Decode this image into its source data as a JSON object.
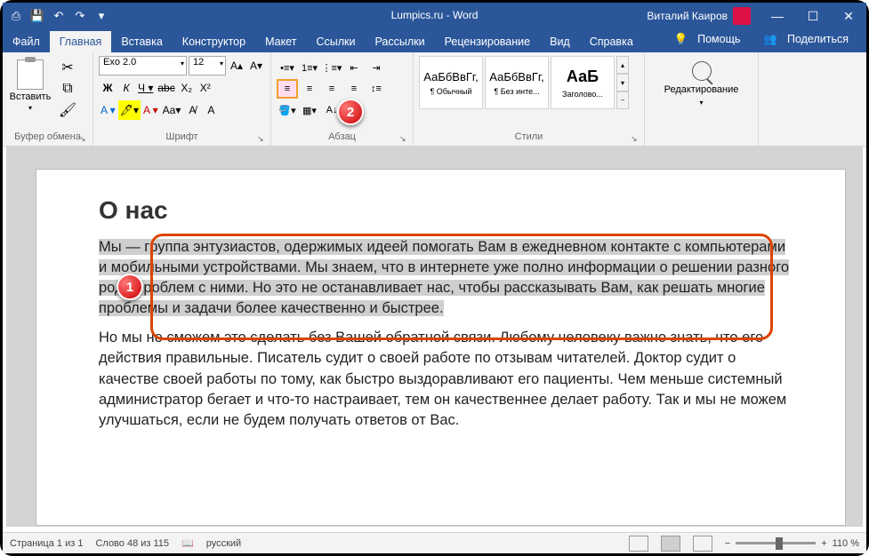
{
  "titlebar": {
    "title": "Lumpics.ru - Word",
    "user": "Виталий Каиров"
  },
  "tabs": {
    "items": [
      "Файл",
      "Главная",
      "Вставка",
      "Конструктор",
      "Макет",
      "Ссылки",
      "Рассылки",
      "Рецензирование",
      "Вид",
      "Справка"
    ],
    "active": 1,
    "help": "Помощь",
    "share": "Поделиться"
  },
  "ribbon": {
    "clipboard": {
      "paste": "Вставить",
      "label": "Буфер обмена"
    },
    "font": {
      "name": "Exo 2.0",
      "size": "12",
      "label": "Шрифт"
    },
    "para": {
      "label": "Абзац"
    },
    "styles": {
      "label": "Стили",
      "items": [
        {
          "preview": "АаБбВвГг,",
          "name": "¶ Обычный"
        },
        {
          "preview": "АаБбВвГг,",
          "name": "¶ Без инте..."
        },
        {
          "preview": "АаБ",
          "name": "Заголово..."
        }
      ]
    },
    "editing": {
      "label": "Редактирование"
    }
  },
  "document": {
    "heading": "О нас",
    "p1": "Мы — группа энтузиастов, одержимых идеей помогать Вам в ежедневном контакте с компьютерами и мобильными устройствами. Мы знаем, что в интернете уже полно информации о решении разного рода проблем с ними. Но это не останавливает нас, чтобы рассказывать Вам, как решать многие проблемы и задачи более качественно и быстрее.",
    "p2": "Но мы не сможем это сделать без Вашей обратной связи. Любому человеку важно знать, что его действия правильные. Писатель судит о своей работе по отзывам читателей. Доктор судит о качестве своей работы по тому, как быстро выздоравливают его пациенты. Чем меньше системный администратор бегает и что-то настраивает, тем он качественнее делает работу. Так и мы не можем улучшаться, если не будем получать ответов от Вас."
  },
  "status": {
    "page": "Страница 1 из 1",
    "words": "Слово 48 из 115",
    "lang": "русский",
    "zoom": "110 %"
  },
  "callouts": {
    "n1": "1",
    "n2": "2"
  }
}
